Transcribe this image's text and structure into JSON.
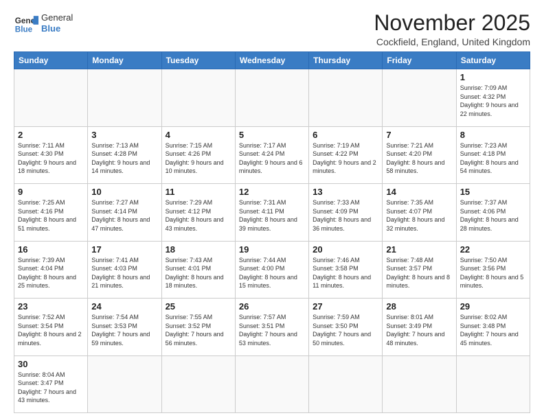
{
  "header": {
    "logo_general": "General",
    "logo_blue": "Blue",
    "title": "November 2025",
    "subtitle": "Cockfield, England, United Kingdom"
  },
  "weekdays": [
    "Sunday",
    "Monday",
    "Tuesday",
    "Wednesday",
    "Thursday",
    "Friday",
    "Saturday"
  ],
  "weeks": [
    [
      {
        "day": "",
        "info": ""
      },
      {
        "day": "",
        "info": ""
      },
      {
        "day": "",
        "info": ""
      },
      {
        "day": "",
        "info": ""
      },
      {
        "day": "",
        "info": ""
      },
      {
        "day": "",
        "info": ""
      },
      {
        "day": "1",
        "info": "Sunrise: 7:09 AM\nSunset: 4:32 PM\nDaylight: 9 hours and 22 minutes."
      }
    ],
    [
      {
        "day": "2",
        "info": "Sunrise: 7:11 AM\nSunset: 4:30 PM\nDaylight: 9 hours and 18 minutes."
      },
      {
        "day": "3",
        "info": "Sunrise: 7:13 AM\nSunset: 4:28 PM\nDaylight: 9 hours and 14 minutes."
      },
      {
        "day": "4",
        "info": "Sunrise: 7:15 AM\nSunset: 4:26 PM\nDaylight: 9 hours and 10 minutes."
      },
      {
        "day": "5",
        "info": "Sunrise: 7:17 AM\nSunset: 4:24 PM\nDaylight: 9 hours and 6 minutes."
      },
      {
        "day": "6",
        "info": "Sunrise: 7:19 AM\nSunset: 4:22 PM\nDaylight: 9 hours and 2 minutes."
      },
      {
        "day": "7",
        "info": "Sunrise: 7:21 AM\nSunset: 4:20 PM\nDaylight: 8 hours and 58 minutes."
      },
      {
        "day": "8",
        "info": "Sunrise: 7:23 AM\nSunset: 4:18 PM\nDaylight: 8 hours and 54 minutes."
      }
    ],
    [
      {
        "day": "9",
        "info": "Sunrise: 7:25 AM\nSunset: 4:16 PM\nDaylight: 8 hours and 51 minutes."
      },
      {
        "day": "10",
        "info": "Sunrise: 7:27 AM\nSunset: 4:14 PM\nDaylight: 8 hours and 47 minutes."
      },
      {
        "day": "11",
        "info": "Sunrise: 7:29 AM\nSunset: 4:12 PM\nDaylight: 8 hours and 43 minutes."
      },
      {
        "day": "12",
        "info": "Sunrise: 7:31 AM\nSunset: 4:11 PM\nDaylight: 8 hours and 39 minutes."
      },
      {
        "day": "13",
        "info": "Sunrise: 7:33 AM\nSunset: 4:09 PM\nDaylight: 8 hours and 36 minutes."
      },
      {
        "day": "14",
        "info": "Sunrise: 7:35 AM\nSunset: 4:07 PM\nDaylight: 8 hours and 32 minutes."
      },
      {
        "day": "15",
        "info": "Sunrise: 7:37 AM\nSunset: 4:06 PM\nDaylight: 8 hours and 28 minutes."
      }
    ],
    [
      {
        "day": "16",
        "info": "Sunrise: 7:39 AM\nSunset: 4:04 PM\nDaylight: 8 hours and 25 minutes."
      },
      {
        "day": "17",
        "info": "Sunrise: 7:41 AM\nSunset: 4:03 PM\nDaylight: 8 hours and 21 minutes."
      },
      {
        "day": "18",
        "info": "Sunrise: 7:43 AM\nSunset: 4:01 PM\nDaylight: 8 hours and 18 minutes."
      },
      {
        "day": "19",
        "info": "Sunrise: 7:44 AM\nSunset: 4:00 PM\nDaylight: 8 hours and 15 minutes."
      },
      {
        "day": "20",
        "info": "Sunrise: 7:46 AM\nSunset: 3:58 PM\nDaylight: 8 hours and 11 minutes."
      },
      {
        "day": "21",
        "info": "Sunrise: 7:48 AM\nSunset: 3:57 PM\nDaylight: 8 hours and 8 minutes."
      },
      {
        "day": "22",
        "info": "Sunrise: 7:50 AM\nSunset: 3:56 PM\nDaylight: 8 hours and 5 minutes."
      }
    ],
    [
      {
        "day": "23",
        "info": "Sunrise: 7:52 AM\nSunset: 3:54 PM\nDaylight: 8 hours and 2 minutes."
      },
      {
        "day": "24",
        "info": "Sunrise: 7:54 AM\nSunset: 3:53 PM\nDaylight: 7 hours and 59 minutes."
      },
      {
        "day": "25",
        "info": "Sunrise: 7:55 AM\nSunset: 3:52 PM\nDaylight: 7 hours and 56 minutes."
      },
      {
        "day": "26",
        "info": "Sunrise: 7:57 AM\nSunset: 3:51 PM\nDaylight: 7 hours and 53 minutes."
      },
      {
        "day": "27",
        "info": "Sunrise: 7:59 AM\nSunset: 3:50 PM\nDaylight: 7 hours and 50 minutes."
      },
      {
        "day": "28",
        "info": "Sunrise: 8:01 AM\nSunset: 3:49 PM\nDaylight: 7 hours and 48 minutes."
      },
      {
        "day": "29",
        "info": "Sunrise: 8:02 AM\nSunset: 3:48 PM\nDaylight: 7 hours and 45 minutes."
      }
    ],
    [
      {
        "day": "30",
        "info": "Sunrise: 8:04 AM\nSunset: 3:47 PM\nDaylight: 7 hours and 43 minutes."
      },
      {
        "day": "",
        "info": ""
      },
      {
        "day": "",
        "info": ""
      },
      {
        "day": "",
        "info": ""
      },
      {
        "day": "",
        "info": ""
      },
      {
        "day": "",
        "info": ""
      },
      {
        "day": "",
        "info": ""
      }
    ]
  ]
}
